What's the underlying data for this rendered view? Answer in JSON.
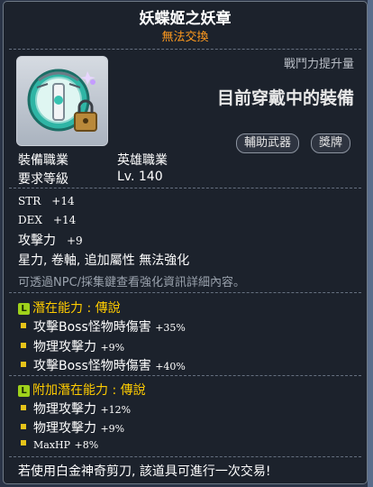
{
  "item": {
    "name": "妖蝶姬之妖章",
    "trade_status": "無法交換",
    "icon": "eye-shield-emblem-icon"
  },
  "compare": {
    "power_label": "戰鬥力提升量",
    "equipped_note": "目前穿戴中的裝備",
    "buttons": [
      "輔助武器",
      "獎牌"
    ]
  },
  "requirements": {
    "job_label": "裝備職業",
    "job_value": "英雄職業",
    "level_label": "要求等級",
    "level_value": "Lv. 140"
  },
  "stats": [
    {
      "name": "STR",
      "value": "+14"
    },
    {
      "name": "DEX",
      "value": "+14"
    },
    {
      "name": "攻擊力",
      "value": "+9"
    }
  ],
  "attributes": "星力, 卷軸, 追加屬性 無法強化",
  "hint": "可透過NPC/採集鍵查看強化資訊詳細內容。",
  "potential": {
    "header": "潛在能力 : 傳說",
    "badge": "L",
    "lines": [
      {
        "text": "攻擊Boss怪物時傷害",
        "value": "+35%"
      },
      {
        "text": "物理攻擊力",
        "value": "+9%"
      },
      {
        "text": "攻擊Boss怪物時傷害",
        "value": "+40%"
      }
    ]
  },
  "additional_potential": {
    "header": "附加潛在能力 : 傳說",
    "badge": "L",
    "lines": [
      {
        "text": "物理攻擊力",
        "value": "+12%"
      },
      {
        "text": "物理攻擊力",
        "value": "+9%"
      },
      {
        "text": "MaxHP",
        "value": "+8%"
      }
    ]
  },
  "footer": "若使用白金神奇剪刀, 該道具可進行一次交易!",
  "colors": {
    "title": "#ffffff",
    "trade": "#ff9a1e",
    "section_header": "#ffcc00",
    "badge": "#9fd21b",
    "bullet": "#e6c31a",
    "hint": "#9aa2ad"
  }
}
